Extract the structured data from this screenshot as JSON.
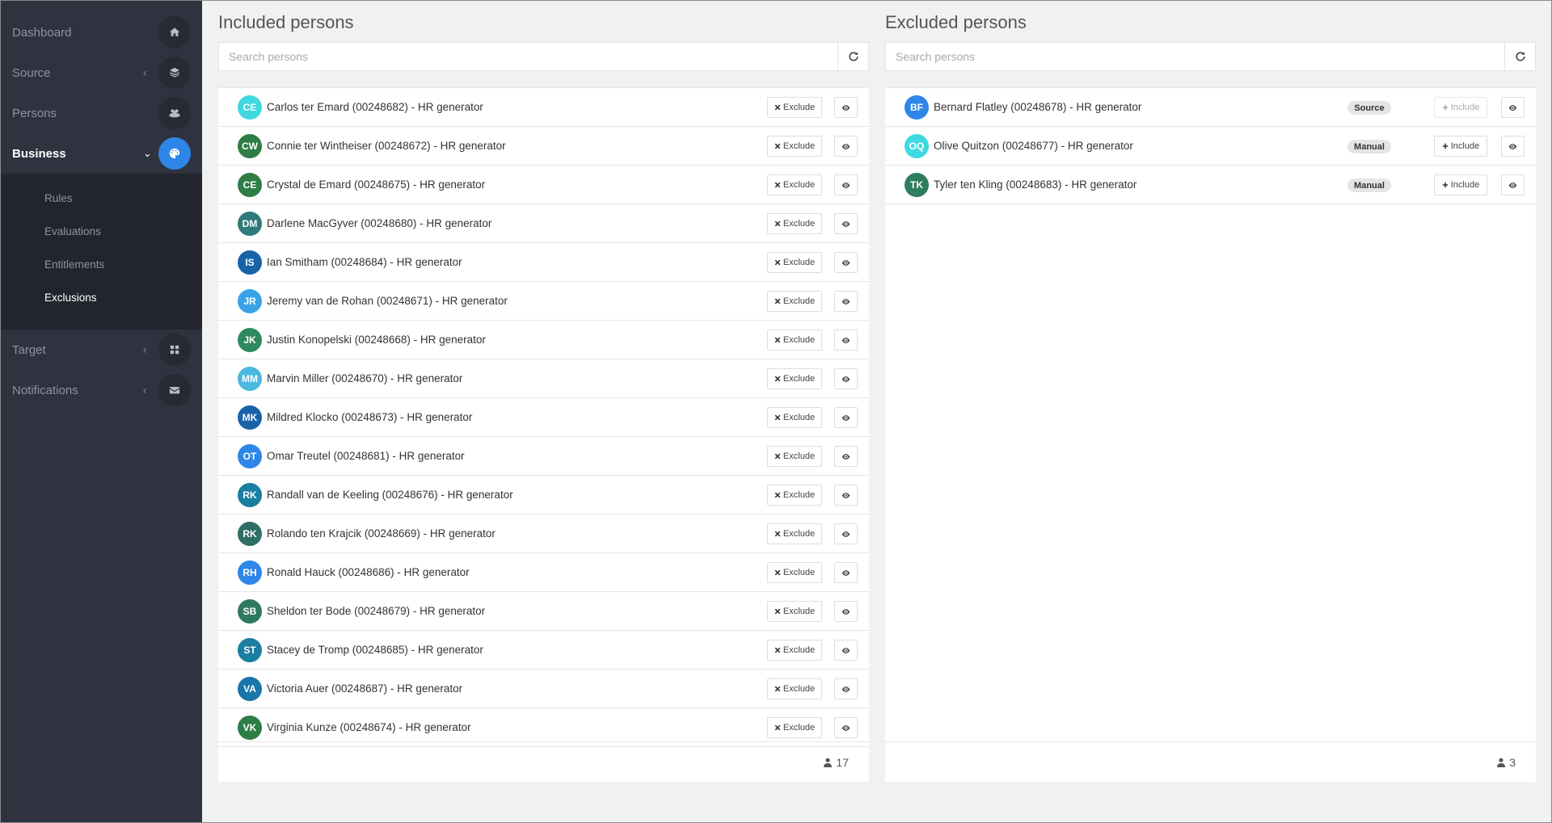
{
  "sidebar": {
    "items": [
      {
        "label": "Dashboard",
        "icon": "home-icon",
        "chevron": ""
      },
      {
        "label": "Source",
        "icon": "layers-icon",
        "chevron": "‹"
      },
      {
        "label": "Persons",
        "icon": "users-icon",
        "chevron": ""
      },
      {
        "label": "Business",
        "icon": "palette-icon",
        "chevron": "⌄"
      },
      {
        "label": "Target",
        "icon": "grid-icon",
        "chevron": "‹"
      },
      {
        "label": "Notifications",
        "icon": "envelope-icon",
        "chevron": "‹"
      }
    ],
    "business_sub": [
      "Rules",
      "Evaluations",
      "Entitlements",
      "Exclusions"
    ],
    "active_item": "Business",
    "active_sub": "Exclusions",
    "active_color": "#2e86e8"
  },
  "included": {
    "title": "Included persons",
    "search_placeholder": "Search persons",
    "exclude_label": "Exclude",
    "count": "17",
    "rows": [
      {
        "initials": "CE",
        "color": "#3fd9e0",
        "label": "Carlos ter Emard (00248682) - HR generator"
      },
      {
        "initials": "CW",
        "color": "#2e7d46",
        "label": "Connie ter Wintheiser (00248672) - HR generator"
      },
      {
        "initials": "CE",
        "color": "#2e7d46",
        "label": "Crystal de Emard (00248675) - HR generator"
      },
      {
        "initials": "DM",
        "color": "#2f7a7a",
        "label": "Darlene MacGyver (00248680) - HR generator"
      },
      {
        "initials": "IS",
        "color": "#1863a8",
        "label": "Ian Smitham (00248684) - HR generator"
      },
      {
        "initials": "JR",
        "color": "#3aa3e8",
        "label": "Jeremy van de Rohan (00248671) - HR generator"
      },
      {
        "initials": "JK",
        "color": "#2e8a5e",
        "label": "Justin Konopelski (00248668) - HR generator"
      },
      {
        "initials": "MM",
        "color": "#4ab8e0",
        "label": "Marvin Miller (00248670) - HR generator"
      },
      {
        "initials": "MK",
        "color": "#1863a8",
        "label": "Mildred Klocko (00248673) - HR generator"
      },
      {
        "initials": "OT",
        "color": "#2e86e8",
        "label": "Omar Treutel (00248681) - HR generator"
      },
      {
        "initials": "RK",
        "color": "#1a7ea0",
        "label": "Randall van de Keeling (00248676) - HR generator"
      },
      {
        "initials": "RK",
        "color": "#2f6e66",
        "label": "Rolando ten Krajcik (00248669) - HR generator"
      },
      {
        "initials": "RH",
        "color": "#2e86e8",
        "label": "Ronald Hauck (00248686) - HR generator"
      },
      {
        "initials": "SB",
        "color": "#2f7a5e",
        "label": "Sheldon ter Bode (00248679) - HR generator"
      },
      {
        "initials": "ST",
        "color": "#1a7ea0",
        "label": "Stacey de Tromp (00248685) - HR generator"
      },
      {
        "initials": "VA",
        "color": "#1a75a8",
        "label": "Victoria Auer (00248687) - HR generator"
      },
      {
        "initials": "VK",
        "color": "#2e7d46",
        "label": "Virginia Kunze (00248674) - HR generator"
      }
    ]
  },
  "excluded": {
    "title": "Excluded persons",
    "search_placeholder": "Search persons",
    "include_label": "Include",
    "count": "3",
    "rows": [
      {
        "initials": "BF",
        "color": "#2e86e8",
        "label": "Bernard Flatley (00248678) - HR generator",
        "badge": "Source",
        "include_disabled": true
      },
      {
        "initials": "OQ",
        "color": "#3fd9e0",
        "label": "Olive Quitzon (00248677) - HR generator",
        "badge": "Manual",
        "include_disabled": false
      },
      {
        "initials": "TK",
        "color": "#2e7d5e",
        "label": "Tyler ten Kling (00248683) - HR generator",
        "badge": "Manual",
        "include_disabled": false
      }
    ]
  }
}
